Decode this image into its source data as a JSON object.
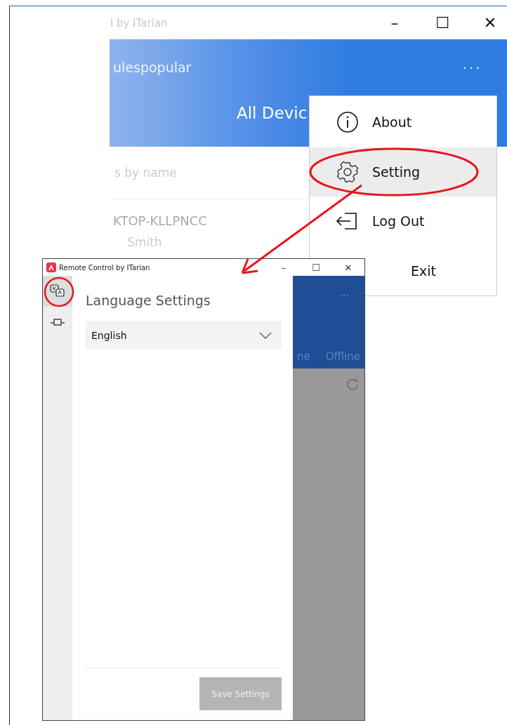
{
  "main_window": {
    "title": "l by ITarian",
    "controls": [
      "–",
      "☐",
      "✕"
    ],
    "header": {
      "account": "ulespopular",
      "more": "···",
      "heading": "All Devic"
    },
    "search": {
      "placeholder": "s by name"
    },
    "device": {
      "name": "KTOP-KLLPNCC",
      "user": "Smith"
    }
  },
  "menu": {
    "items": [
      {
        "kind": "about",
        "label": "About",
        "selected": false
      },
      {
        "kind": "settings",
        "label": "Setting",
        "selected": true
      },
      {
        "kind": "logout",
        "label": "Log Out",
        "selected": false
      },
      {
        "kind": "exit",
        "label": "Exit",
        "selected": false
      }
    ]
  },
  "settings_window": {
    "title": "Remote Control by ITarian",
    "controls": [
      "–",
      "☐",
      "✕"
    ],
    "sidebar": {
      "items": [
        {
          "kind": "language",
          "selected": true
        },
        {
          "kind": "plugin",
          "selected": false
        }
      ]
    },
    "heading": "Language Settings",
    "language": {
      "value": "English"
    },
    "save_button": {
      "label": "Save Settings",
      "disabled": true
    },
    "behind": {
      "more": "···",
      "tabs": [
        "ne",
        "Offline"
      ]
    }
  }
}
